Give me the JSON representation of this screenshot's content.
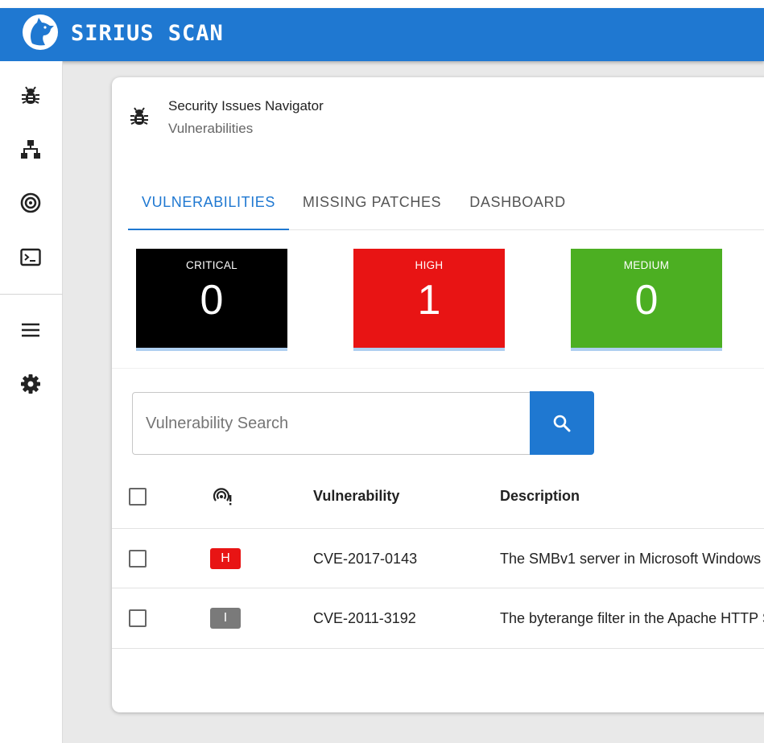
{
  "app": {
    "title": "SIRIUS SCAN",
    "accent_color": "#1f78d1",
    "logo_icon": "wolf-head-logo"
  },
  "sidebar": {
    "items": [
      {
        "icon": "bug-icon"
      },
      {
        "icon": "sitemap-icon"
      },
      {
        "icon": "target-icon"
      },
      {
        "icon": "terminal-icon"
      },
      {
        "icon": "menu-icon"
      },
      {
        "icon": "gear-icon"
      }
    ]
  },
  "card": {
    "icon": "bug-icon",
    "title": "Security Issues Navigator",
    "subtitle": "Vulnerabilities"
  },
  "tabs": [
    {
      "label": "VULNERABILITIES",
      "active": true
    },
    {
      "label": "MISSING PATCHES",
      "active": false
    },
    {
      "label": "DASHBOARD",
      "active": false
    }
  ],
  "severity_counts": [
    {
      "label": "CRITICAL",
      "count": "0",
      "color": "#000000"
    },
    {
      "label": "HIGH",
      "count": "1",
      "color": "#e81414"
    },
    {
      "label": "MEDIUM",
      "count": "0",
      "color": "#4caf22"
    }
  ],
  "search": {
    "placeholder": "Vulnerability Search",
    "value": "",
    "button_icon": "search-icon"
  },
  "table": {
    "columns": {
      "severity_icon": "broadcast-alert-icon",
      "vulnerability": "Vulnerability",
      "description": "Description"
    },
    "rows": [
      {
        "severity": "H",
        "severity_color": "#e81414",
        "vulnerability": "CVE-2017-0143",
        "description": "The SMBv1 server in Microsoft Windows"
      },
      {
        "severity": "I",
        "severity_color": "#7a7a7a",
        "vulnerability": "CVE-2011-3192",
        "description": "The byterange filter in the Apache HTTP S"
      }
    ]
  }
}
